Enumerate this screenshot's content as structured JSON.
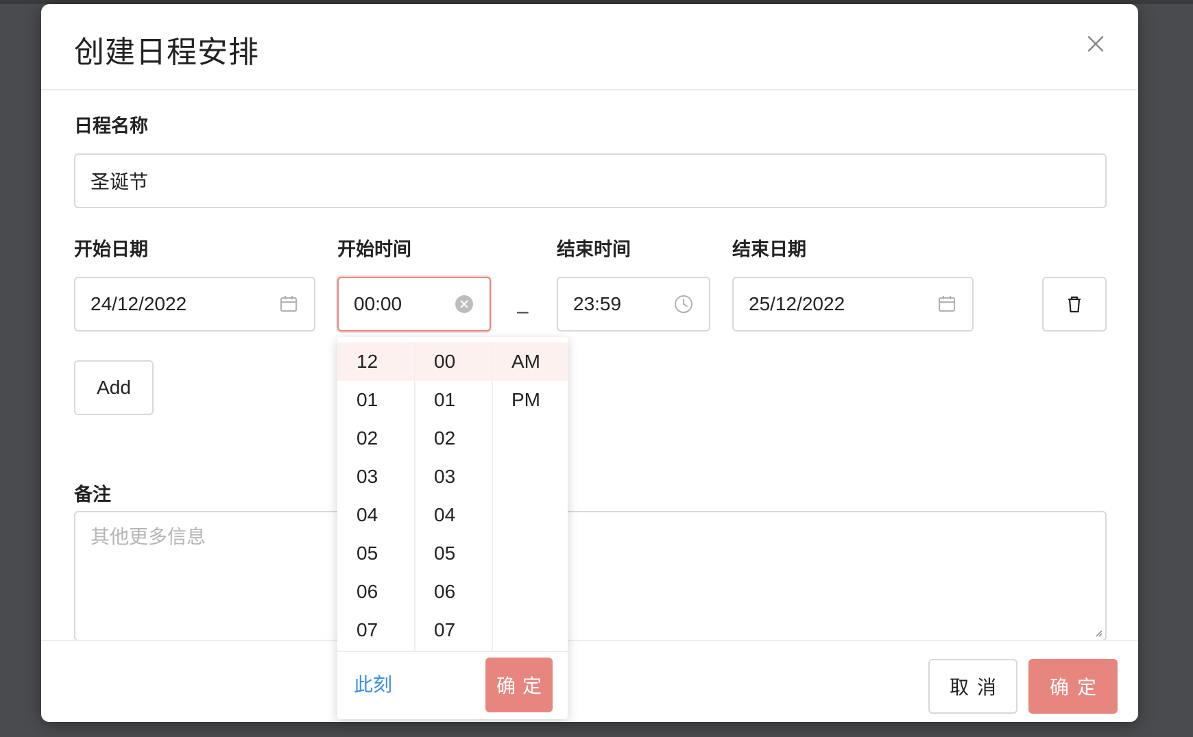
{
  "dialog": {
    "title": "创建日程安排"
  },
  "form": {
    "name_label": "日程名称",
    "name_value": "圣诞节",
    "start_date_label": "开始日期",
    "start_date_value": "24/12/2022",
    "start_time_label": "开始时间",
    "start_time_value": "00:00",
    "range_separator": "–",
    "end_time_label": "结束时间",
    "end_time_value": "23:59",
    "end_date_label": "结束日期",
    "end_date_value": "25/12/2022",
    "add_label": "Add",
    "notes_label": "备注",
    "notes_placeholder": "其他更多信息"
  },
  "time_picker": {
    "hours": [
      "12",
      "01",
      "02",
      "03",
      "04",
      "05",
      "06",
      "07"
    ],
    "minutes": [
      "00",
      "01",
      "02",
      "03",
      "04",
      "05",
      "06",
      "07"
    ],
    "meridiem": [
      "AM",
      "PM"
    ],
    "selected_hour": "12",
    "selected_minute": "00",
    "selected_meridiem": "AM",
    "now_label": "此刻",
    "ok_label": "确定"
  },
  "footer": {
    "cancel_label": "取消",
    "ok_label": "确定"
  },
  "colors": {
    "accent": "#e7867f",
    "link": "#3a8ee6",
    "backdrop": "#4a4b4e"
  },
  "icons": {
    "close": "close-icon",
    "calendar": "calendar-icon",
    "clear": "clear-circle-icon",
    "clock": "clock-icon",
    "delete": "trash-icon"
  }
}
